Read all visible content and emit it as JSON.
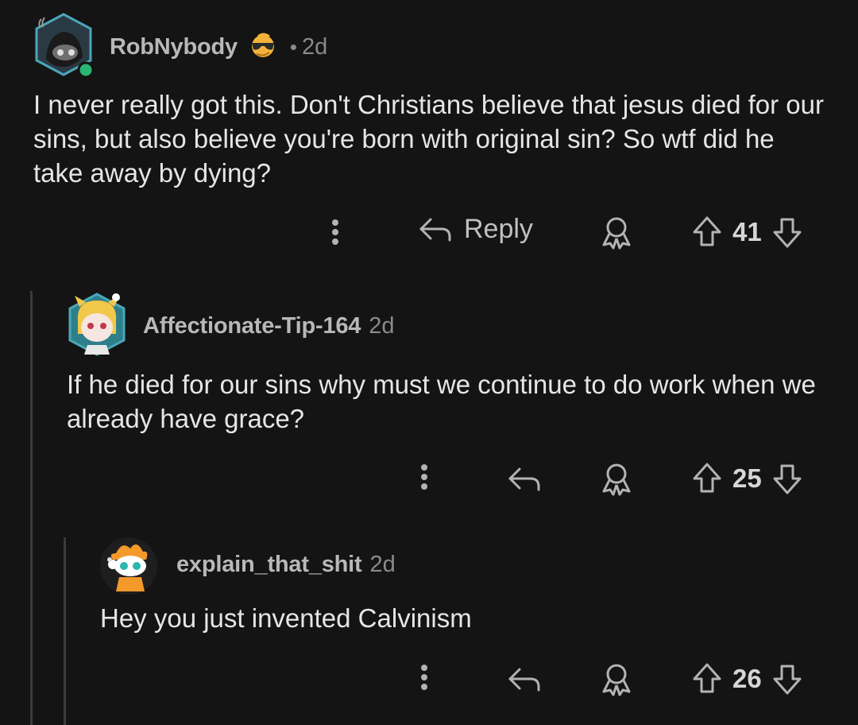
{
  "comments": [
    {
      "username": "RobNybody",
      "flair_icon": "sunglasses-emoji-icon",
      "separator": "•",
      "age": "2d",
      "text": "I never really got this. Don't Christians believe that jesus died for our sins, but also believe you're born with original sin? So wtf did he take away by dying?",
      "reply_label": "Reply",
      "votes": "41",
      "online_status_color": "#2bb673"
    },
    {
      "username": "Affectionate-Tip-164",
      "age": "2d",
      "text": "If he died for our sins why must we continue to do work when we already have grace?",
      "votes": "25"
    },
    {
      "username": "explain_that_shit",
      "age": "2d",
      "text": "Hey you just invented Calvinism",
      "votes": "26"
    }
  ],
  "icons": {
    "more": "more-vertical-icon",
    "reply": "reply-arrow-icon",
    "award": "award-icon",
    "upvote": "upvote-arrow-icon",
    "downvote": "downvote-arrow-icon"
  },
  "colors": {
    "background": "#141414",
    "text": "#e6e6e6",
    "muted": "#8a8a8a",
    "thread_line": "#3b3b3b"
  }
}
